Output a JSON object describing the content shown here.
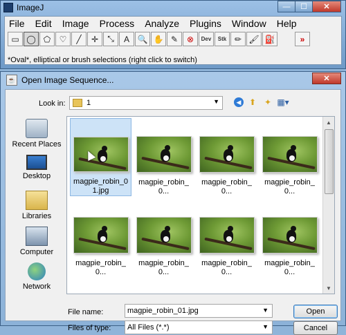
{
  "imagej": {
    "title": "ImageJ",
    "window_buttons": {
      "minimize": "—",
      "maximize": "☐",
      "close": "✕"
    },
    "menu": [
      "File",
      "Edit",
      "Image",
      "Process",
      "Analyze",
      "Plugins",
      "Window",
      "Help"
    ],
    "tools": [
      {
        "name": "rectangle-tool-icon",
        "glyph": "▭"
      },
      {
        "name": "oval-tool-icon",
        "glyph": "◯"
      },
      {
        "name": "polygon-tool-icon",
        "glyph": "⬠"
      },
      {
        "name": "freehand-tool-icon",
        "glyph": "♡"
      },
      {
        "name": "line-tool-icon",
        "glyph": "╱"
      },
      {
        "name": "point-tool-icon",
        "glyph": "✛"
      },
      {
        "name": "wand-tool-icon",
        "glyph": "⤡"
      },
      {
        "name": "text-tool-icon",
        "glyph": "A"
      },
      {
        "name": "magnifier-tool-icon",
        "glyph": "🔍"
      },
      {
        "name": "hand-tool-icon",
        "glyph": "✋"
      },
      {
        "name": "color-picker-tool-icon",
        "glyph": "✎"
      },
      {
        "name": "stop-tool-icon",
        "glyph": "⊗"
      },
      {
        "name": "developer-menu-icon",
        "glyph": "Dev"
      },
      {
        "name": "stack-menu-icon",
        "glyph": "Stk"
      },
      {
        "name": "pencil-tool-icon",
        "glyph": "✏"
      },
      {
        "name": "brush-tool-icon",
        "glyph": "🖌"
      },
      {
        "name": "flood-fill-tool-icon",
        "glyph": "⛽"
      }
    ],
    "more_tools": "»",
    "status": "*Oval*, elliptical or brush selections (right click to switch)"
  },
  "dialog": {
    "title": "Open Image Sequence...",
    "close": "✕",
    "look_in_label": "Look in:",
    "look_in_value": "1",
    "places": [
      {
        "label": "Recent Places",
        "icon": "recent-places-icon"
      },
      {
        "label": "Desktop",
        "icon": "desktop-icon"
      },
      {
        "label": "Libraries",
        "icon": "libraries-icon"
      },
      {
        "label": "Computer",
        "icon": "computer-icon"
      },
      {
        "label": "Network",
        "icon": "network-icon"
      }
    ],
    "files": [
      "magpie_robin_01.jpg",
      "magpie_robin_0...",
      "magpie_robin_0...",
      "magpie_robin_0...",
      "magpie_robin_0...",
      "magpie_robin_0...",
      "magpie_robin_0...",
      "magpie_robin_0..."
    ],
    "file_name_label": "File name:",
    "file_name_value": "magpie_robin_01.jpg",
    "files_of_type_label": "Files of type:",
    "files_of_type_value": "All Files (*.*)",
    "open_button": "Open",
    "cancel_button": "Cancel"
  }
}
